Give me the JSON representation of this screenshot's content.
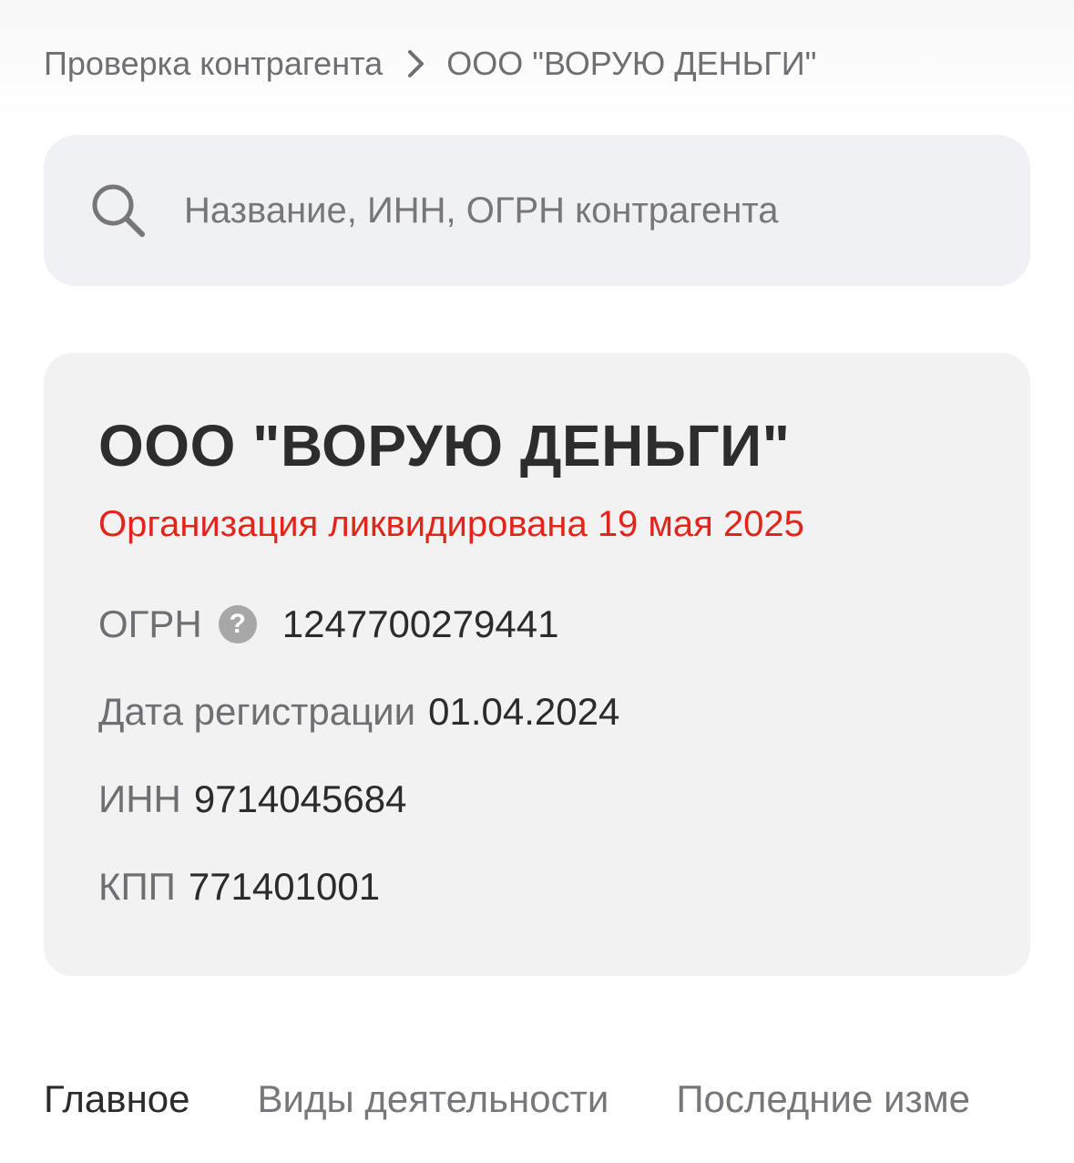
{
  "breadcrumb": {
    "parent": "Проверка контрагента",
    "current": "ООО \"ВОРУЮ ДЕНЬГИ\"",
    "separator_icon": "chevron-right-icon"
  },
  "search": {
    "placeholder": "Название, ИНН, ОГРН контрагента",
    "value": "",
    "icon": "search-icon"
  },
  "company": {
    "name": "ООО \"ВОРУЮ ДЕНЬГИ\"",
    "status": "Организация ликвидирована 19 мая 2025",
    "status_color": "#e1251b",
    "ogrn_label": "ОГРН",
    "ogrn_help_glyph": "?",
    "ogrn_value": "1247700279441",
    "reg_date_label": "Дата регистрации",
    "reg_date_value": "01.04.2024",
    "inn_label": "ИНН",
    "inn_value": "9714045684",
    "kpp_label": "КПП",
    "kpp_value": "771401001"
  },
  "tabs": [
    {
      "label": "Главное",
      "active": true
    },
    {
      "label": "Виды деятельности",
      "active": false
    },
    {
      "label": "Последние изме",
      "active": false
    }
  ],
  "colors": {
    "search_bg": "#eff1f4",
    "card_bg": "#f2f2f2",
    "muted_text": "#6f6f73",
    "primary_text": "#2b2b2b"
  }
}
